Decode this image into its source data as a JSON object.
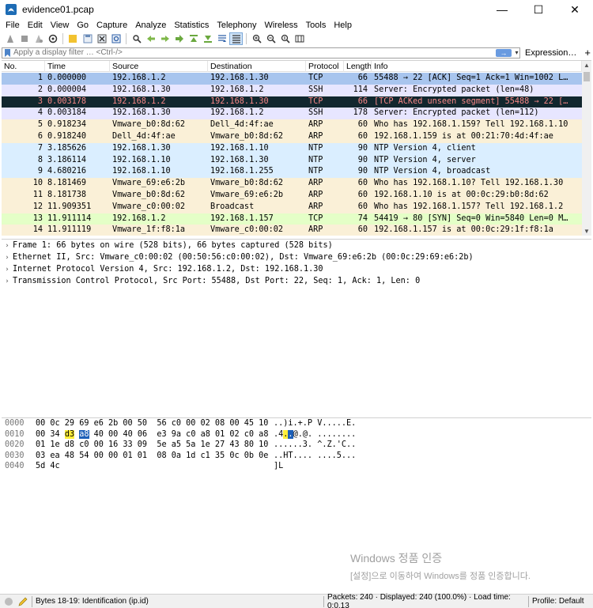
{
  "window": {
    "title": "evidence01.pcap",
    "minimize": "—",
    "maximize": "☐",
    "close": "✕"
  },
  "menu": [
    "File",
    "Edit",
    "View",
    "Go",
    "Capture",
    "Analyze",
    "Statistics",
    "Telephony",
    "Wireless",
    "Tools",
    "Help"
  ],
  "filter": {
    "placeholder": "Apply a display filter … <Ctrl-/>",
    "apply": "→",
    "dropdown": "▾",
    "expression": "Expression…",
    "add": "+"
  },
  "packet_list": {
    "headers": [
      "No.",
      "Time",
      "Source",
      "Destination",
      "Protocol",
      "Length",
      "Info"
    ],
    "rows": [
      {
        "no": "1",
        "time": "0.000000",
        "src": "192.168.1.2",
        "dst": "192.168.1.30",
        "proto": "TCP",
        "len": "66",
        "info": "55488 → 22 [ACK] Seq=1 Ack=1 Win=1002 L…",
        "bg": "#a8c5ee",
        "fg": "#000000"
      },
      {
        "no": "2",
        "time": "0.000004",
        "src": "192.168.1.30",
        "dst": "192.168.1.2",
        "proto": "SSH",
        "len": "114",
        "info": "Server: Encrypted packet (len=48)",
        "bg": "#e7e6ff",
        "fg": "#000000"
      },
      {
        "no": "3",
        "time": "0.003178",
        "src": "192.168.1.2",
        "dst": "192.168.1.30",
        "proto": "TCP",
        "len": "66",
        "info": "[TCP ACKed unseen segment] 55488 → 22 […",
        "bg": "#12272e",
        "fg": "#f78787"
      },
      {
        "no": "4",
        "time": "0.003184",
        "src": "192.168.1.30",
        "dst": "192.168.1.2",
        "proto": "SSH",
        "len": "178",
        "info": "Server: Encrypted packet (len=112)",
        "bg": "#e7e6ff",
        "fg": "#000000"
      },
      {
        "no": "5",
        "time": "0.918234",
        "src": "Vmware_b0:8d:62",
        "dst": "Dell_4d:4f:ae",
        "proto": "ARP",
        "len": "60",
        "info": "Who has 192.168.1.159? Tell 192.168.1.10",
        "bg": "#faf0d7",
        "fg": "#000000"
      },
      {
        "no": "6",
        "time": "0.918240",
        "src": "Dell_4d:4f:ae",
        "dst": "Vmware_b0:8d:62",
        "proto": "ARP",
        "len": "60",
        "info": "192.168.1.159 is at 00:21:70:4d:4f:ae",
        "bg": "#faf0d7",
        "fg": "#000000"
      },
      {
        "no": "7",
        "time": "3.185626",
        "src": "192.168.1.30",
        "dst": "192.168.1.10",
        "proto": "NTP",
        "len": "90",
        "info": "NTP Version 4, client",
        "bg": "#daeeff",
        "fg": "#000000"
      },
      {
        "no": "8",
        "time": "3.186114",
        "src": "192.168.1.10",
        "dst": "192.168.1.30",
        "proto": "NTP",
        "len": "90",
        "info": "NTP Version 4, server",
        "bg": "#daeeff",
        "fg": "#000000"
      },
      {
        "no": "9",
        "time": "4.680216",
        "src": "192.168.1.10",
        "dst": "192.168.1.255",
        "proto": "NTP",
        "len": "90",
        "info": "NTP Version 4, broadcast",
        "bg": "#daeeff",
        "fg": "#000000"
      },
      {
        "no": "10",
        "time": "8.181469",
        "src": "Vmware_69:e6:2b",
        "dst": "Vmware_b0:8d:62",
        "proto": "ARP",
        "len": "60",
        "info": "Who has 192.168.1.10? Tell 192.168.1.30",
        "bg": "#faf0d7",
        "fg": "#000000"
      },
      {
        "no": "11",
        "time": "8.181738",
        "src": "Vmware_b0:8d:62",
        "dst": "Vmware_69:e6:2b",
        "proto": "ARP",
        "len": "60",
        "info": "192.168.1.10 is at 00:0c:29:b0:8d:62",
        "bg": "#faf0d7",
        "fg": "#000000"
      },
      {
        "no": "12",
        "time": "11.909351",
        "src": "Vmware_c0:00:02",
        "dst": "Broadcast",
        "proto": "ARP",
        "len": "60",
        "info": "Who has 192.168.1.157? Tell 192.168.1.2",
        "bg": "#faf0d7",
        "fg": "#000000"
      },
      {
        "no": "13",
        "time": "11.911114",
        "src": "192.168.1.2",
        "dst": "192.168.1.157",
        "proto": "TCP",
        "len": "74",
        "info": "54419 → 80 [SYN] Seq=0 Win=5840 Len=0 M…",
        "bg": "#e4ffc7",
        "fg": "#000000"
      },
      {
        "no": "14",
        "time": "11.911119",
        "src": "Vmware_1f:f8:1a",
        "dst": "Vmware_c0:00:02",
        "proto": "ARP",
        "len": "60",
        "info": "192.168.1.157 is at 00:0c:29:1f:f8:1a",
        "bg": "#faf0d7",
        "fg": "#000000"
      }
    ]
  },
  "detail": {
    "expander": "›",
    "lines": [
      "Frame 1: 66 bytes on wire (528 bits), 66 bytes captured (528 bits)",
      "Ethernet II, Src: Vmware_c0:00:02 (00:50:56:c0:00:02), Dst: Vmware_69:e6:2b (00:0c:29:69:e6:2b)",
      "Internet Protocol Version 4, Src: 192.168.1.2, Dst: 192.168.1.30",
      "Transmission Control Protocol, Src Port: 55488, Dst Port: 22, Seq: 1, Ack: 1, Len: 0"
    ]
  },
  "bytes": {
    "rows": [
      {
        "offset": "0000",
        "hex": [
          {
            "t": "00 0c 29 69 e6 2b 00 50  56 c0 00 02 08 00 45 10"
          }
        ],
        "ascii": [
          {
            "t": "..)i.+.P V.....E."
          }
        ]
      },
      {
        "offset": "0010",
        "hex": [
          {
            "t": "00 34 "
          },
          {
            "t": "d3",
            "hl": "yellow"
          },
          {
            "t": " "
          },
          {
            "t": "a8",
            "hl": "blue"
          },
          {
            "t": " 40 00 40 06  e3 9a c0 a8 01 02 c0 a8"
          }
        ],
        "ascii": [
          {
            "t": ".4"
          },
          {
            "t": ".",
            "hl": "yellow"
          },
          {
            "t": ".",
            "hl": "blue"
          },
          {
            "t": "@.@. ........"
          }
        ]
      },
      {
        "offset": "0020",
        "hex": [
          {
            "t": "01 1e d8 c0 00 16 33 09  5e a5 5a 1e 27 43 80 10"
          }
        ],
        "ascii": [
          {
            "t": "......3. ^.Z.'C.."
          }
        ]
      },
      {
        "offset": "0030",
        "hex": [
          {
            "t": "03 ea 48 54 00 00 01 01  08 0a 1d c1 35 0c 0b 0e"
          }
        ],
        "ascii": [
          {
            "t": "..HT.... ....5..."
          }
        ]
      },
      {
        "offset": "0040",
        "hex": [
          {
            "t": "5d 4c"
          }
        ],
        "ascii": [
          {
            "t": "]L"
          }
        ]
      }
    ]
  },
  "watermark": {
    "line1": "Windows 정품 인증",
    "line2": "[설정]으로 이동하여 Windows를 정품 인증합니다."
  },
  "status": {
    "field": "Bytes 18-19: Identification (ip.id)",
    "packets": "Packets: 240 · Displayed: 240 (100.0%) · Load time: 0:0.13",
    "profile": "Profile: Default"
  },
  "colors": {
    "accent": "#1c5fb8",
    "highlight": "#ffef3a",
    "selected_row": "#a8c5ee"
  }
}
